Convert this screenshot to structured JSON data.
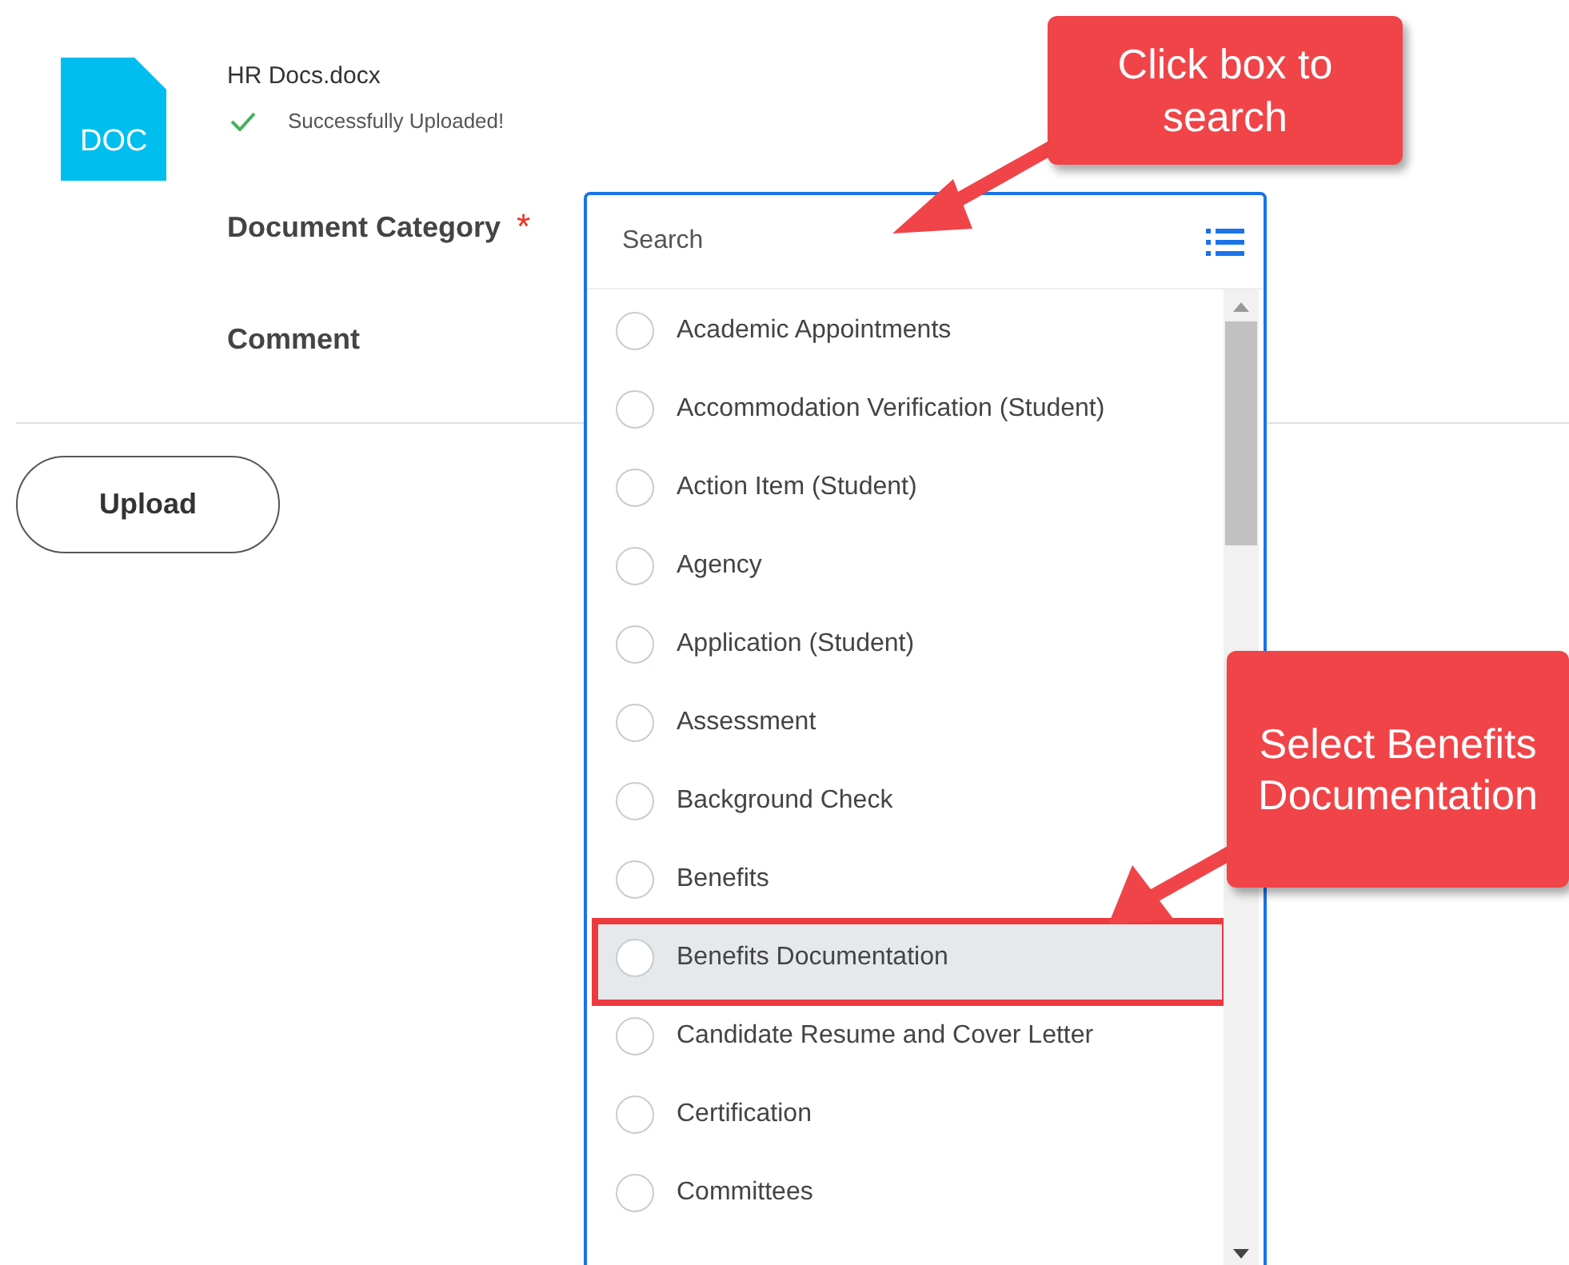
{
  "file": {
    "icon_label": "DOC",
    "name": "HR Docs.docx",
    "status": "Successfully Uploaded!"
  },
  "form": {
    "category_label": "Document Category",
    "required_mark": "*",
    "comment_label": "Comment"
  },
  "upload_button": "Upload",
  "dropdown": {
    "search_placeholder": "Search",
    "options": [
      {
        "label": "Academic Appointments",
        "selected": false,
        "highlighted": false
      },
      {
        "label": "Accommodation Verification (Student)",
        "selected": false,
        "highlighted": false
      },
      {
        "label": "Action Item (Student)",
        "selected": false,
        "highlighted": false
      },
      {
        "label": "Agency",
        "selected": false,
        "highlighted": false
      },
      {
        "label": "Application (Student)",
        "selected": false,
        "highlighted": false
      },
      {
        "label": "Assessment",
        "selected": false,
        "highlighted": false
      },
      {
        "label": "Background Check",
        "selected": false,
        "highlighted": false
      },
      {
        "label": "Benefits",
        "selected": false,
        "highlighted": false
      },
      {
        "label": "Benefits Documentation",
        "selected": false,
        "highlighted": true
      },
      {
        "label": "Candidate Resume and Cover Letter",
        "selected": false,
        "highlighted": false
      },
      {
        "label": "Certification",
        "selected": false,
        "highlighted": false
      },
      {
        "label": "Committees",
        "selected": false,
        "highlighted": false
      }
    ]
  },
  "annotations": [
    {
      "text": "Click box to search"
    },
    {
      "text": "Select Benefits Documentation"
    }
  ]
}
